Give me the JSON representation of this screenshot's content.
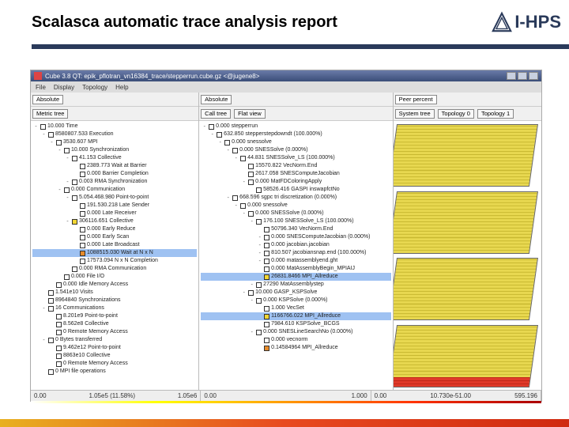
{
  "slide": {
    "title": "Scalasca automatic trace analysis report",
    "logo_text": "I-HPS"
  },
  "window": {
    "title": "Cube 3.8 QT: epik_pflotran_vn16384_trace/stepperrun.cube.gz <@jugene8>",
    "menus": [
      "File",
      "Display",
      "Topology",
      "Help"
    ]
  },
  "panel_left": {
    "dropdown": "Absolute",
    "tab": "Metric tree",
    "items": [
      {
        "ind": 0,
        "tg": "-",
        "c": "w",
        "t": "10.000 Time"
      },
      {
        "ind": 1,
        "tg": "-",
        "c": "w",
        "t": "8580807.533 Execution"
      },
      {
        "ind": 2,
        "tg": "-",
        "c": "w",
        "t": "3530.607 MPI"
      },
      {
        "ind": 3,
        "tg": "-",
        "c": "w",
        "t": "10.000 Synchronization"
      },
      {
        "ind": 4,
        "tg": "-",
        "c": "w",
        "t": "41.153 Collective"
      },
      {
        "ind": 5,
        "tg": "",
        "c": "w",
        "t": "2389.773 Wait at Barrier"
      },
      {
        "ind": 5,
        "tg": "",
        "c": "w",
        "t": "0.000 Barrier Completion"
      },
      {
        "ind": 4,
        "tg": "-",
        "c": "w",
        "t": "0.003 RMA Synchronization"
      },
      {
        "ind": 3,
        "tg": "-",
        "c": "w",
        "t": "0.000 Communication"
      },
      {
        "ind": 4,
        "tg": "-",
        "c": "w",
        "t": "5.054.468.980 Point-to-point"
      },
      {
        "ind": 5,
        "tg": "",
        "c": "w",
        "t": "191.530.218 Late Sender"
      },
      {
        "ind": 5,
        "tg": "",
        "c": "w",
        "t": "0.000 Late Receiver"
      },
      {
        "ind": 4,
        "tg": "-",
        "c": "y",
        "t": "306116.651 Collective"
      },
      {
        "ind": 5,
        "tg": "",
        "c": "w",
        "t": "0.000 Early Reduce"
      },
      {
        "ind": 5,
        "tg": "",
        "c": "w",
        "t": "0.000 Early Scan"
      },
      {
        "ind": 5,
        "tg": "",
        "c": "w",
        "t": "0.000 Late Broadcast"
      },
      {
        "ind": 5,
        "tg": "",
        "c": "o",
        "t": "1088515.030 Wait at N x N",
        "sel": true
      },
      {
        "ind": 5,
        "tg": "",
        "c": "w",
        "t": "17573.094 N x N Completion"
      },
      {
        "ind": 4,
        "tg": "",
        "c": "w",
        "t": "0.000 RMA Communication"
      },
      {
        "ind": 3,
        "tg": "",
        "c": "w",
        "t": "0.000 File I/O"
      },
      {
        "ind": 2,
        "tg": "",
        "c": "w",
        "t": "0.000 Idle Memory Access"
      },
      {
        "ind": 1,
        "tg": "",
        "c": "w",
        "t": "1.541e10 Visits"
      },
      {
        "ind": 1,
        "tg": "",
        "c": "w",
        "t": "8964840 Synchronizations"
      },
      {
        "ind": 1,
        "tg": "-",
        "c": "w",
        "t": "16 Communications"
      },
      {
        "ind": 2,
        "tg": "",
        "c": "w",
        "t": "8.201e9 Point-to-point"
      },
      {
        "ind": 2,
        "tg": "",
        "c": "w",
        "t": "8.562e8 Collective"
      },
      {
        "ind": 2,
        "tg": "",
        "c": "w",
        "t": "0 Remote Memory Access"
      },
      {
        "ind": 1,
        "tg": "-",
        "c": "w",
        "t": "0 Bytes transferred"
      },
      {
        "ind": 2,
        "tg": "",
        "c": "w",
        "t": "9.462e12 Point-to-point"
      },
      {
        "ind": 2,
        "tg": "",
        "c": "w",
        "t": "8863e10 Collective"
      },
      {
        "ind": 2,
        "tg": "",
        "c": "w",
        "t": "0 Remote Memory Access"
      },
      {
        "ind": 1,
        "tg": "",
        "c": "w",
        "t": "0 MPI file operations"
      }
    ]
  },
  "panel_mid": {
    "dropdown": "Absolute",
    "tab": "Call tree",
    "tab2": "Flat view",
    "items": [
      {
        "ind": 0,
        "tg": "-",
        "c": "w",
        "t": "0.000 stepperrun"
      },
      {
        "ind": 1,
        "tg": "-",
        "c": "w",
        "t": "632.850 stepperstepdowndt (100.000%)"
      },
      {
        "ind": 2,
        "tg": "-",
        "c": "w",
        "t": "0.000 snessolve"
      },
      {
        "ind": 3,
        "tg": "-",
        "c": "w",
        "t": "0.000 SNESSolve (0.000%)"
      },
      {
        "ind": 4,
        "tg": "-",
        "c": "w",
        "t": "44.831 SNESSolve_LS (100.000%)"
      },
      {
        "ind": 5,
        "tg": "",
        "c": "w",
        "t": "15570.822 VecNorm.End"
      },
      {
        "ind": 5,
        "tg": "",
        "c": "w",
        "t": "2617.058 SNESComputeJacobian"
      },
      {
        "ind": 5,
        "tg": "-",
        "c": "w",
        "t": "0.000 MatFDColoringApply"
      },
      {
        "ind": 6,
        "tg": "",
        "c": "w",
        "t": "58526.416 GASPI inswapfctNo"
      },
      {
        "ind": 3,
        "tg": "-",
        "c": "w",
        "t": "668.596 sgpc tri discretization (0.000%)"
      },
      {
        "ind": 4,
        "tg": "-",
        "c": "w",
        "t": "0.000 snessolve"
      },
      {
        "ind": 5,
        "tg": "-",
        "c": "w",
        "t": "0.000 SNESSolve (0.000%)"
      },
      {
        "ind": 6,
        "tg": "-",
        "c": "w",
        "t": "176.100 SNESSolve_LS (100.000%)"
      },
      {
        "ind": 7,
        "tg": "",
        "c": "w",
        "t": "50796.340 VecNorm.End"
      },
      {
        "ind": 7,
        "tg": "-",
        "c": "w",
        "t": "0.000 SNESComputeJacobian (0.000%)"
      },
      {
        "ind": 7,
        "tg": "-",
        "c": "w",
        "t": "0.000 jacobian.jacobian"
      },
      {
        "ind": 7,
        "tg": "-",
        "c": "w",
        "t": "810.507 jacobiansnap.end (100.000%)"
      },
      {
        "ind": 7,
        "tg": "-",
        "c": "w",
        "t": "0.000 matassemblyend.ght"
      },
      {
        "ind": 7,
        "tg": "",
        "c": "w",
        "t": "0.000 MatAssemblyBegin_MPIAIJ"
      },
      {
        "ind": 7,
        "tg": "",
        "c": "y",
        "t": "26831.8466 MPI_Allreduce",
        "sel": true
      },
      {
        "ind": 6,
        "tg": "-",
        "c": "w",
        "t": "27290 MatAssemblystep"
      },
      {
        "ind": 5,
        "tg": "-",
        "c": "w",
        "t": "10.000 GASP_KSPSolve"
      },
      {
        "ind": 6,
        "tg": "-",
        "c": "w",
        "t": "0.000 KSPSolve (0.000%)"
      },
      {
        "ind": 7,
        "tg": "",
        "c": "w",
        "t": "1.000 VecSet"
      },
      {
        "ind": 7,
        "tg": "",
        "c": "y",
        "t": "1166766.022 MPI_Allreduce",
        "sel": true
      },
      {
        "ind": 7,
        "tg": "",
        "c": "w",
        "t": "7984.610 KSPSolve_BCGS"
      },
      {
        "ind": 6,
        "tg": "-",
        "c": "w",
        "t": "0.000 SNESLineSearchNo (0.000%)"
      },
      {
        "ind": 7,
        "tg": "",
        "c": "w",
        "t": "0.000 vecnorm"
      },
      {
        "ind": 7,
        "tg": "",
        "c": "o",
        "t": "0.14584964 MPI_Allreduce"
      }
    ]
  },
  "panel_right": {
    "dropdown": "Peer percent",
    "tab1": "System tree",
    "tab2": "Topology 0",
    "tab3": "Topology 1"
  },
  "status": {
    "left_a": "0.00",
    "left_b": "1.05e5 (11.58%)",
    "left_c": "1.05e6",
    "mid_a": "0.00",
    "mid_b": "",
    "mid_c": "1.000",
    "right_a": "0.00",
    "right_b": "10.730e-51.00",
    "right_c": "595.196"
  }
}
